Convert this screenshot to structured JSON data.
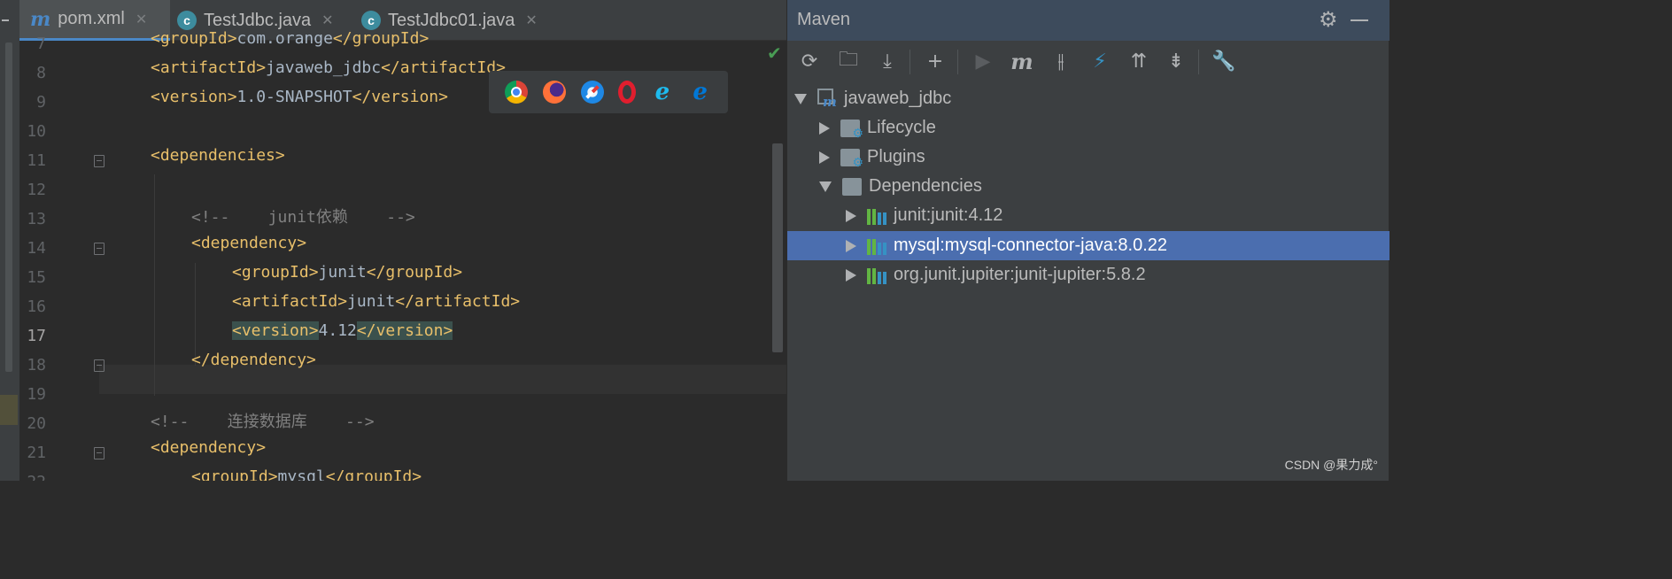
{
  "editor": {
    "tabs": [
      {
        "label": "pom.xml",
        "icon": "maven-m-icon",
        "active": true
      },
      {
        "label": "TestJdbc.java",
        "icon": "java-class-icon",
        "active": false
      },
      {
        "label": "TestJdbc01.java",
        "icon": "java-class-icon",
        "active": false
      }
    ],
    "lines": [
      {
        "num": "7",
        "t1": "<groupId>",
        "t2": "com.orange",
        "t3": "</groupId>"
      },
      {
        "num": "8",
        "t1": "<artifactId>",
        "t2": "javaweb_jdbc",
        "t3": "</artifactId>"
      },
      {
        "num": "9",
        "t1": "<version>",
        "t2": "1.0-SNAPSHOT",
        "t3": "</version>"
      },
      {
        "num": "10"
      },
      {
        "num": "11",
        "t1": "<dependencies>"
      },
      {
        "num": "12"
      },
      {
        "num": "13",
        "c": "<!--    junit依赖    -->"
      },
      {
        "num": "14",
        "t1": "<dependency>"
      },
      {
        "num": "15",
        "t1": "<groupId>",
        "t2": "junit",
        "t3": "</groupId>"
      },
      {
        "num": "16",
        "t1": "<artifactId>",
        "t2": "junit",
        "t3": "</artifactId>"
      },
      {
        "num": "17",
        "t1": "<version>",
        "t2": "4.12",
        "t3": "</version>"
      },
      {
        "num": "18",
        "t1": "</dependency>"
      },
      {
        "num": "19"
      },
      {
        "num": "20",
        "c": "<!--    连接数据库    -->"
      },
      {
        "num": "21",
        "t1": "<dependency>"
      },
      {
        "num": "22",
        "t1": "<groupId>",
        "t2": "mysql",
        "t3": "</groupId>"
      }
    ]
  },
  "browsers": [
    "chrome-icon",
    "firefox-icon",
    "safari-icon",
    "opera-icon",
    "ie-icon",
    "edge-icon"
  ],
  "maven": {
    "title": "Maven",
    "project": "javaweb_jdbc",
    "lifecycle": "Lifecycle",
    "plugins": "Plugins",
    "dependencies": "Dependencies",
    "deps": [
      {
        "label": "junit:junit:4.12",
        "selected": false
      },
      {
        "label": "mysql:mysql-connector-java:8.0.22",
        "selected": true
      },
      {
        "label": "org.junit.jupiter:junit-jupiter:5.8.2",
        "selected": false
      }
    ],
    "selection_color": "#4b6eaf"
  },
  "watermark": "CSDN @果力成°"
}
